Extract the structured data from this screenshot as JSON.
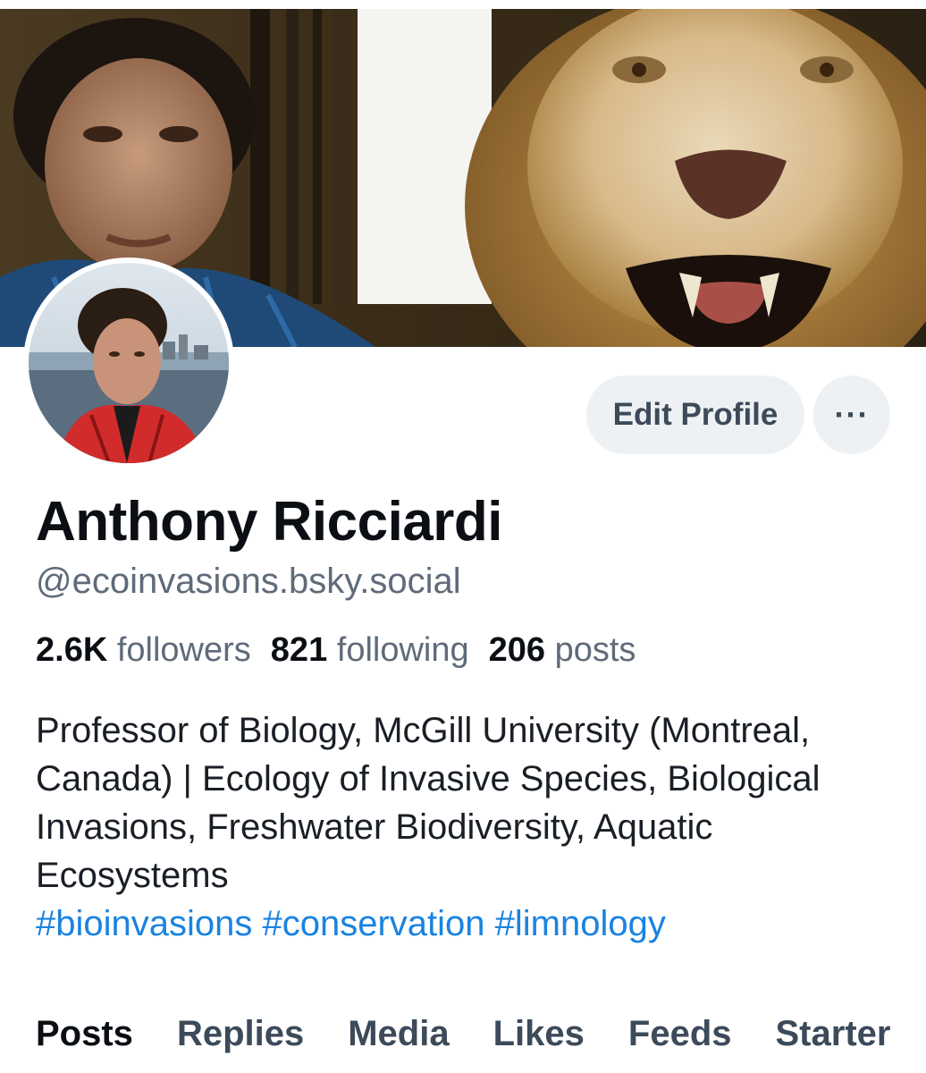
{
  "profile": {
    "display_name": "Anthony Ricciardi",
    "handle": "@ecoinvasions.bsky.social",
    "stats": {
      "followers_count": "2.6K",
      "followers_label": "followers",
      "following_count": "821",
      "following_label": "following",
      "posts_count": "206",
      "posts_label": "posts"
    },
    "bio": {
      "text": "Professor of Biology, McGill University (Montreal, Canada) | Ecology of Invasive Species, Biological Invasions, Freshwater Biodiversity, Aquatic Ecosystems",
      "hashtags": "#bioinvasions #conservation #limnology"
    }
  },
  "actions": {
    "edit_profile_label": "Edit Profile",
    "more_label": "···"
  },
  "tabs": [
    {
      "label": "Posts",
      "active": true
    },
    {
      "label": "Replies",
      "active": false
    },
    {
      "label": "Media",
      "active": false
    },
    {
      "label": "Likes",
      "active": false
    },
    {
      "label": "Feeds",
      "active": false
    },
    {
      "label": "Starter",
      "active": false
    }
  ],
  "colors": {
    "accent_link": "#1a83e0",
    "button_bg": "#eef1f4",
    "muted_text": "#5f6b7a"
  },
  "icons": {
    "more": "more-horizontal-icon"
  }
}
